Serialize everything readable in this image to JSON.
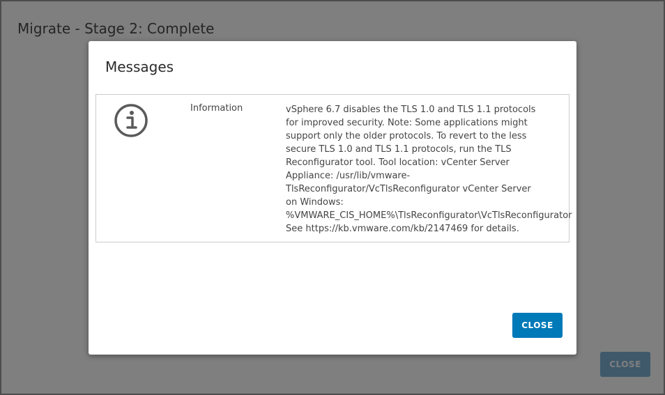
{
  "background": {
    "title": "Migrate - Stage 2: Complete",
    "close_label": "CLOSE"
  },
  "modal": {
    "title": "Messages",
    "message": {
      "icon": "info-circle-icon",
      "type": "Information",
      "lines": [
        "vSphere 6.7 disables the TLS 1.0 and TLS 1.1 protocols",
        "for improved security. Note: Some applications might",
        "support only the older protocols. To revert to the less",
        "secure TLS 1.0 and TLS 1.1 protocols, run the TLS",
        "Reconfigurator tool. Tool location: vCenter Server",
        "Appliance: /usr/lib/vmware-",
        "TlsReconfigurator/VcTlsReconfigurator vCenter Server",
        "on Windows:",
        "%VMWARE_CIS_HOME%\\TlsReconfigurator\\VcTlsReconfigurator",
        "See https://kb.vmware.com/kb/2147469 for details."
      ]
    },
    "close_label": "CLOSE"
  },
  "colors": {
    "primary_button": "#0079b8",
    "overlay": "rgba(0,0,0,0.5)"
  }
}
